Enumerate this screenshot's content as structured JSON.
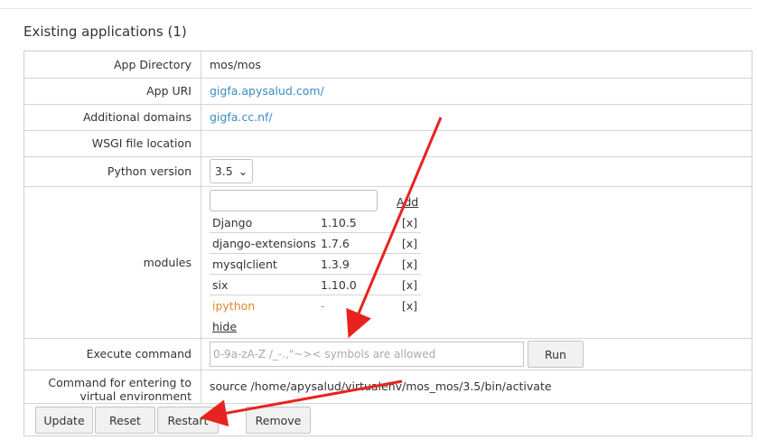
{
  "section": {
    "title": "Existing applications (1)"
  },
  "rows": {
    "app_directory": {
      "label": "App Directory",
      "value": "mos/mos"
    },
    "app_uri": {
      "label": "App URI",
      "value": "gigfa.apysalud.com/"
    },
    "additional_domains": {
      "label": "Additional domains",
      "value": "gigfa.cc.nf/"
    },
    "wsgi": {
      "label": "WSGI file location",
      "value": ""
    },
    "python_version": {
      "label": "Python version",
      "value": "3.5",
      "chevron": "⌄"
    },
    "modules": {
      "label": "modules",
      "add_label": "Add",
      "hide_label": "hide",
      "items": [
        {
          "name": "Django",
          "version": "1.10.5",
          "remove": "[x]"
        },
        {
          "name": "django-extensions",
          "version": "1.7.6",
          "remove": "[x]"
        },
        {
          "name": "mysqlclient",
          "version": "1.3.9",
          "remove": "[x]"
        },
        {
          "name": "six",
          "version": "1.10.0",
          "remove": "[x]"
        },
        {
          "name": "ipython",
          "version": "-",
          "remove": "[x]"
        }
      ]
    },
    "execute": {
      "label": "Execute command",
      "placeholder": "0-9a-zA-Z /_-.,\"~>< symbols are allowed",
      "run_label": "Run"
    },
    "venv": {
      "label_line1": "Command for entering to",
      "label_line2": "virtual environment",
      "value": "source /home/apysalud/virtualenv/mos_mos/3.5/bin/activate"
    }
  },
  "buttons": {
    "update": "Update",
    "reset": "Reset",
    "restart": "Restart",
    "remove": "Remove"
  },
  "colors": {
    "link": "#3d8bc2",
    "warning": "#e08a2e",
    "annotation_arrow": "#e8231f"
  }
}
